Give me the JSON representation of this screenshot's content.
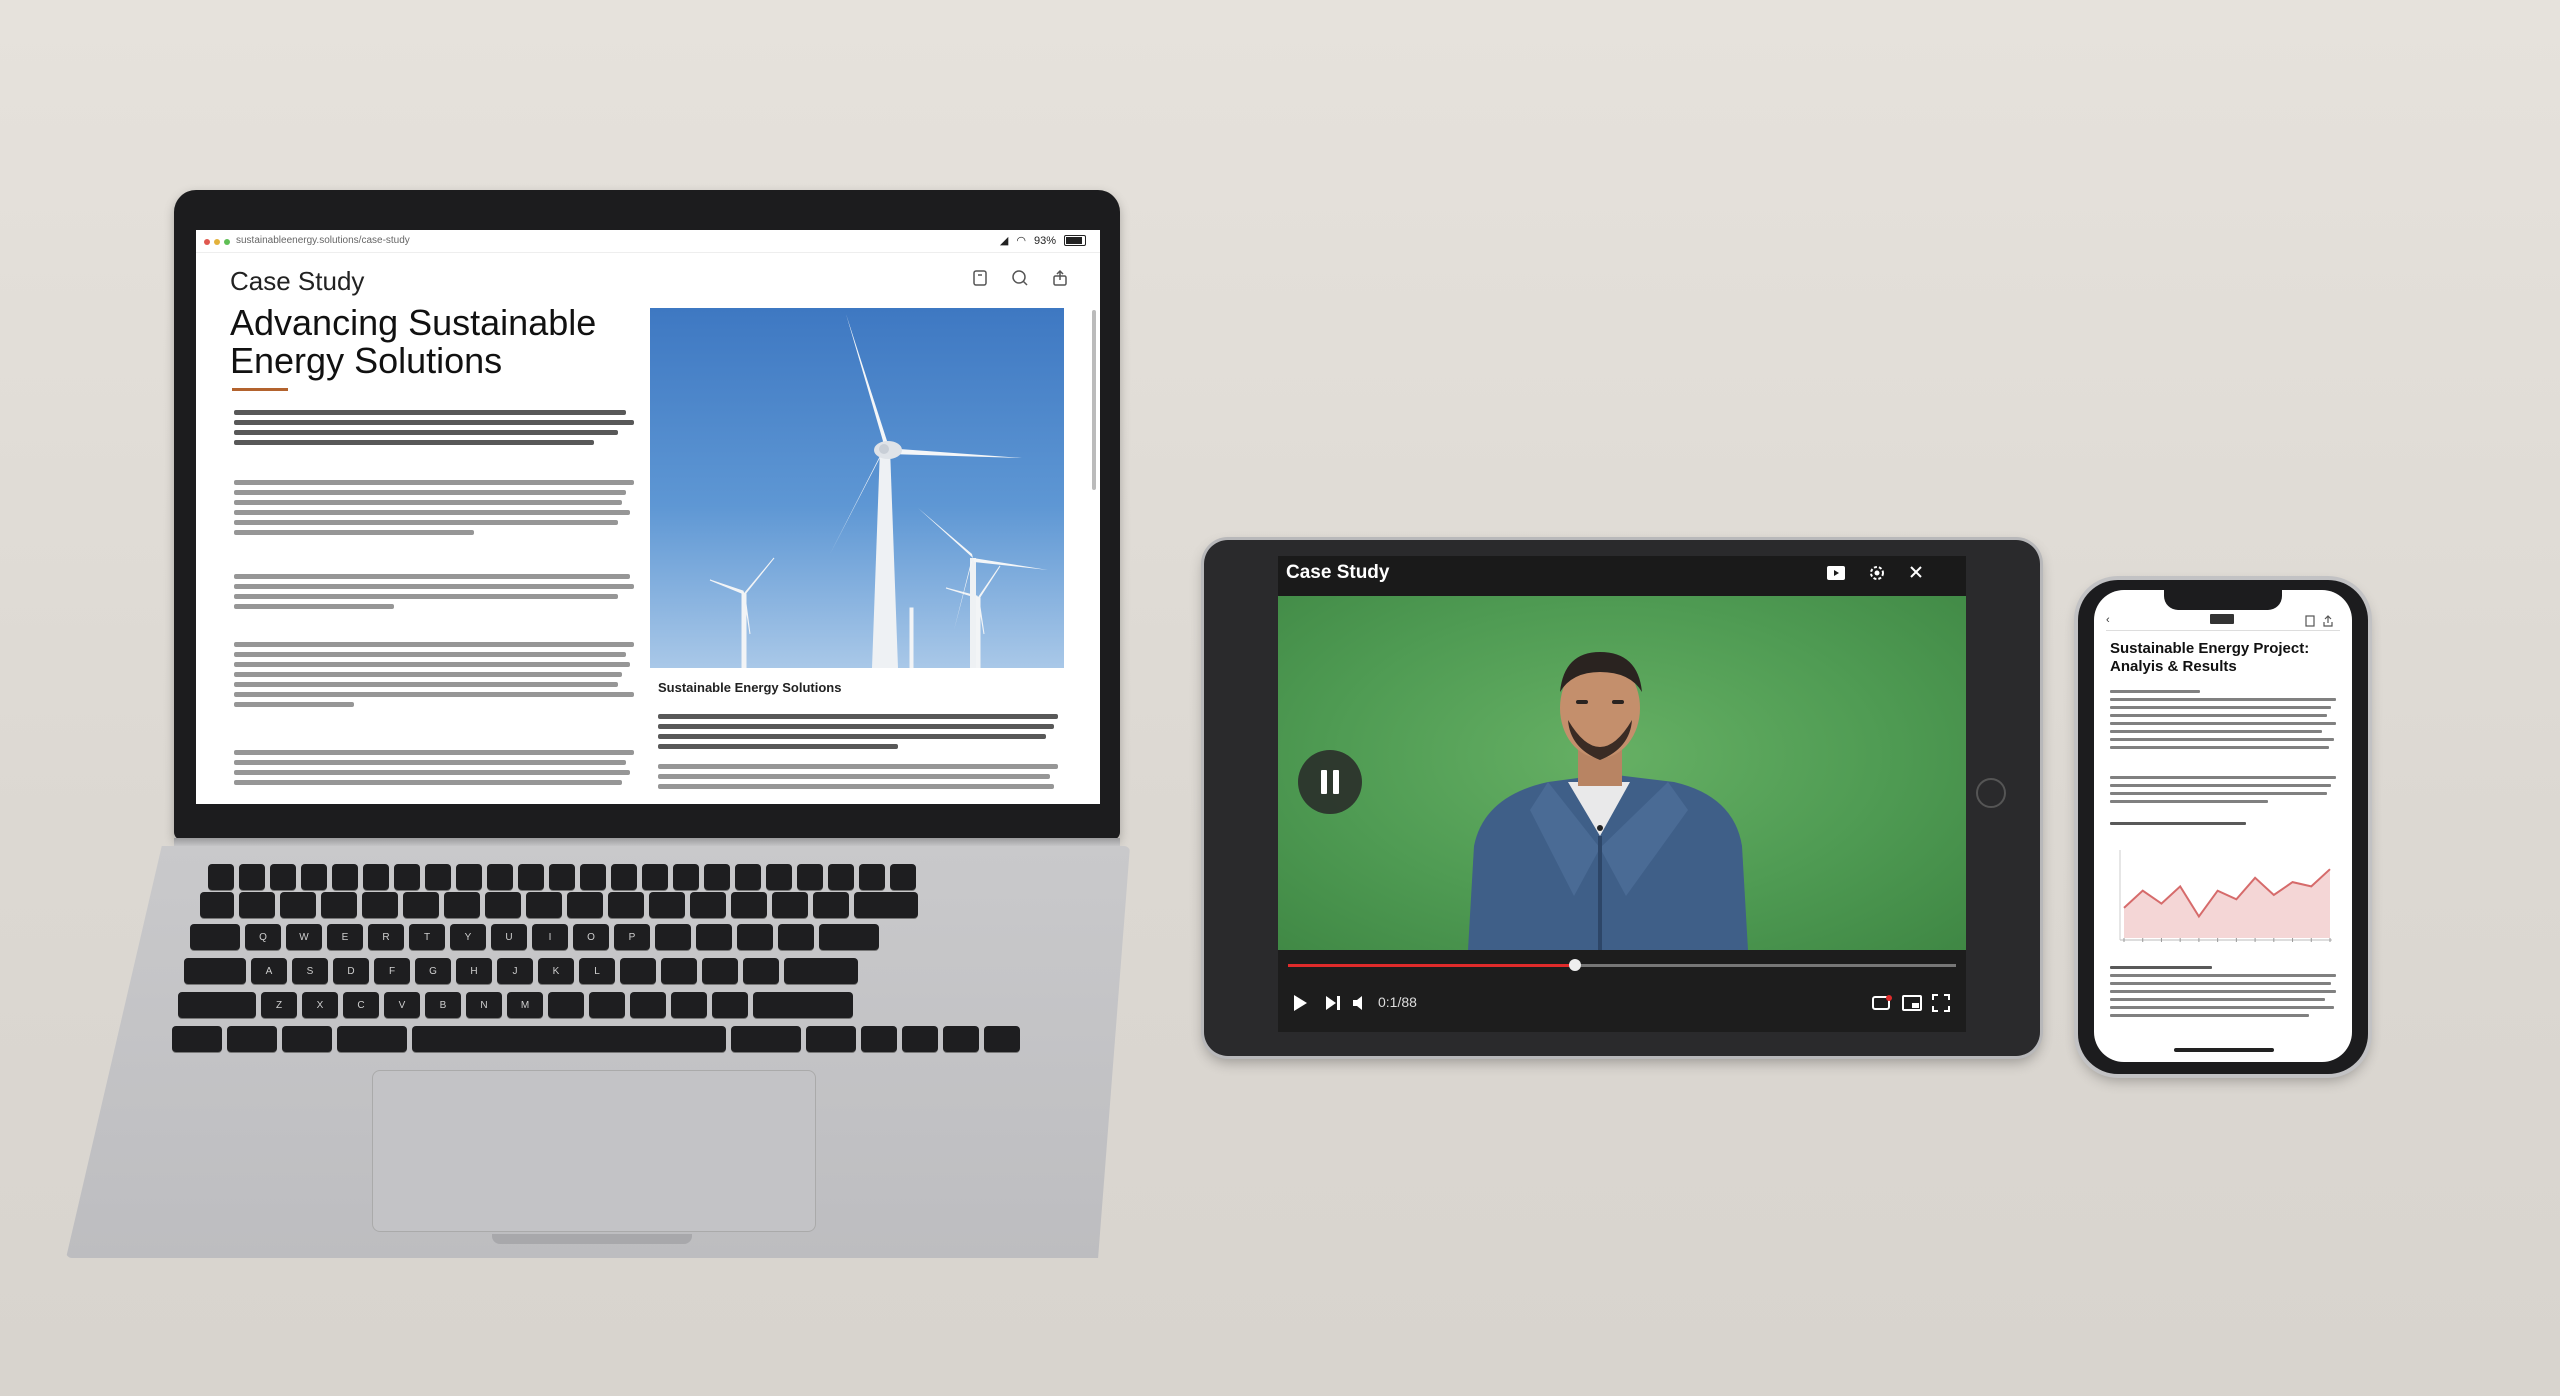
{
  "laptop": {
    "status_url": "sustainableenergy.solutions/case-study",
    "battery": "93%",
    "kicker": "Case Study",
    "title": "Advancing Sustainable Energy Solutions",
    "image_caption": "Sustainable Energy Solutions",
    "toolbar_icons": [
      "bookmark-icon",
      "search-icon",
      "share-icon"
    ]
  },
  "tablet": {
    "title": "Case Study",
    "time": "0:1/88",
    "top_icons": [
      "cast-icon",
      "settings-icon",
      "close-icon"
    ],
    "controls": [
      "play-icon",
      "next-icon",
      "volume-icon",
      "subtitles-icon",
      "miniplayer-icon",
      "fullscreen-icon"
    ],
    "progress": 0.43,
    "colors": {
      "progress": "#e02b2b",
      "screen_bg": "#4f9b53"
    }
  },
  "phone": {
    "title": "Sustainable Energy Project: Analyis & Results",
    "chart_trend": [
      0.35,
      0.55,
      0.4,
      0.6,
      0.25,
      0.55,
      0.45,
      0.7,
      0.5,
      0.65,
      0.6,
      0.8
    ],
    "colors": {
      "line": "#d66b6b",
      "fill": "#f4d6d6"
    }
  }
}
